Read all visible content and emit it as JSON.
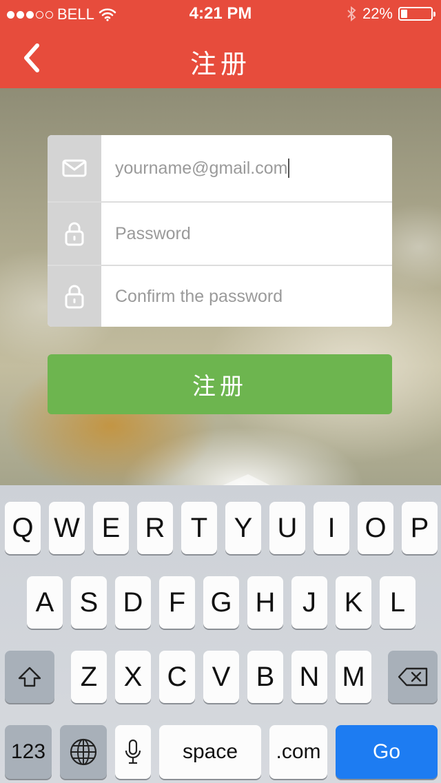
{
  "status_bar": {
    "carrier": "BELL",
    "time": "4:21 PM",
    "battery_percent": "22%",
    "battery_level": 0.22,
    "signal_dots_filled": 3,
    "signal_dots_total": 5
  },
  "nav": {
    "title": "注册",
    "back_icon": "chevron-left-icon"
  },
  "form": {
    "email": {
      "value": "yourname@gmail.com",
      "icon": "mail-icon"
    },
    "password": {
      "placeholder": "Password",
      "icon": "lock-icon"
    },
    "confirm_password": {
      "placeholder": "Confirm the password",
      "icon": "lock-icon"
    }
  },
  "submit_label": "注册",
  "keyboard": {
    "row1": [
      "Q",
      "W",
      "E",
      "R",
      "T",
      "Y",
      "U",
      "I",
      "O",
      "P"
    ],
    "row2": [
      "A",
      "S",
      "D",
      "F",
      "G",
      "H",
      "J",
      "K",
      "L"
    ],
    "row3": [
      "Z",
      "X",
      "C",
      "V",
      "B",
      "N",
      "M"
    ],
    "numbers_label": "123",
    "space_label": "space",
    "dotcom_label": ".com",
    "go_label": "Go"
  },
  "colors": {
    "accent": "#e74c3c",
    "submit": "#6db54f",
    "go": "#1d7cf2"
  }
}
